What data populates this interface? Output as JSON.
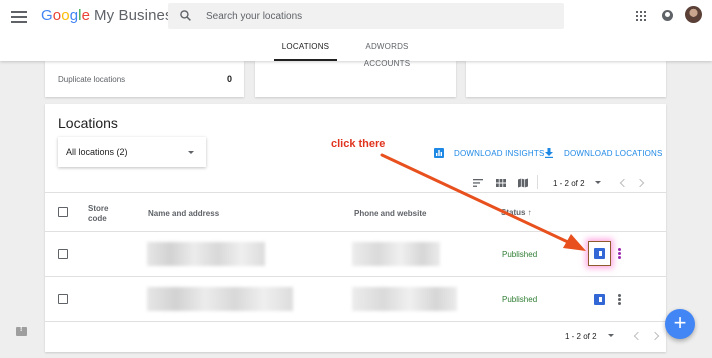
{
  "header": {
    "logo_google": [
      "G",
      "o",
      "o",
      "g",
      "l",
      "e"
    ],
    "logo_product": "My Business",
    "search_placeholder": "Search your locations"
  },
  "tabs": [
    {
      "label": "LOCATIONS",
      "active": true
    },
    {
      "label": "ADWORDS ACCOUNTS",
      "active": false
    }
  ],
  "stats": {
    "duplicate_label": "Duplicate locations",
    "duplicate_value": "0"
  },
  "locations": {
    "title": "Locations",
    "filter_value": "All locations (2)",
    "annotation": "click there",
    "download_insights": "DOWNLOAD INSIGHTS",
    "download_locations": "DOWNLOAD LOCATIONS",
    "pager": "1 - 2 of 2",
    "columns": {
      "store_code": "Store code",
      "name_address": "Name and address",
      "phone_website": "Phone and website",
      "status": "Status ↑"
    },
    "rows": [
      {
        "status": "Published"
      },
      {
        "status": "Published"
      }
    ]
  },
  "colors": {
    "accent": "#1e88e5",
    "published": "#2e7d32",
    "annotation": "#e0341f",
    "fab": "#4285f4"
  },
  "icons": [
    "menu-icon",
    "search-icon",
    "apps-icon",
    "notifications-icon",
    "avatar",
    "bar-chart-icon",
    "download-icon",
    "sort-icon",
    "grid-view-icon",
    "map-view-icon",
    "verified-badge-icon",
    "more-vert-icon",
    "add-icon",
    "feedback-icon"
  ]
}
